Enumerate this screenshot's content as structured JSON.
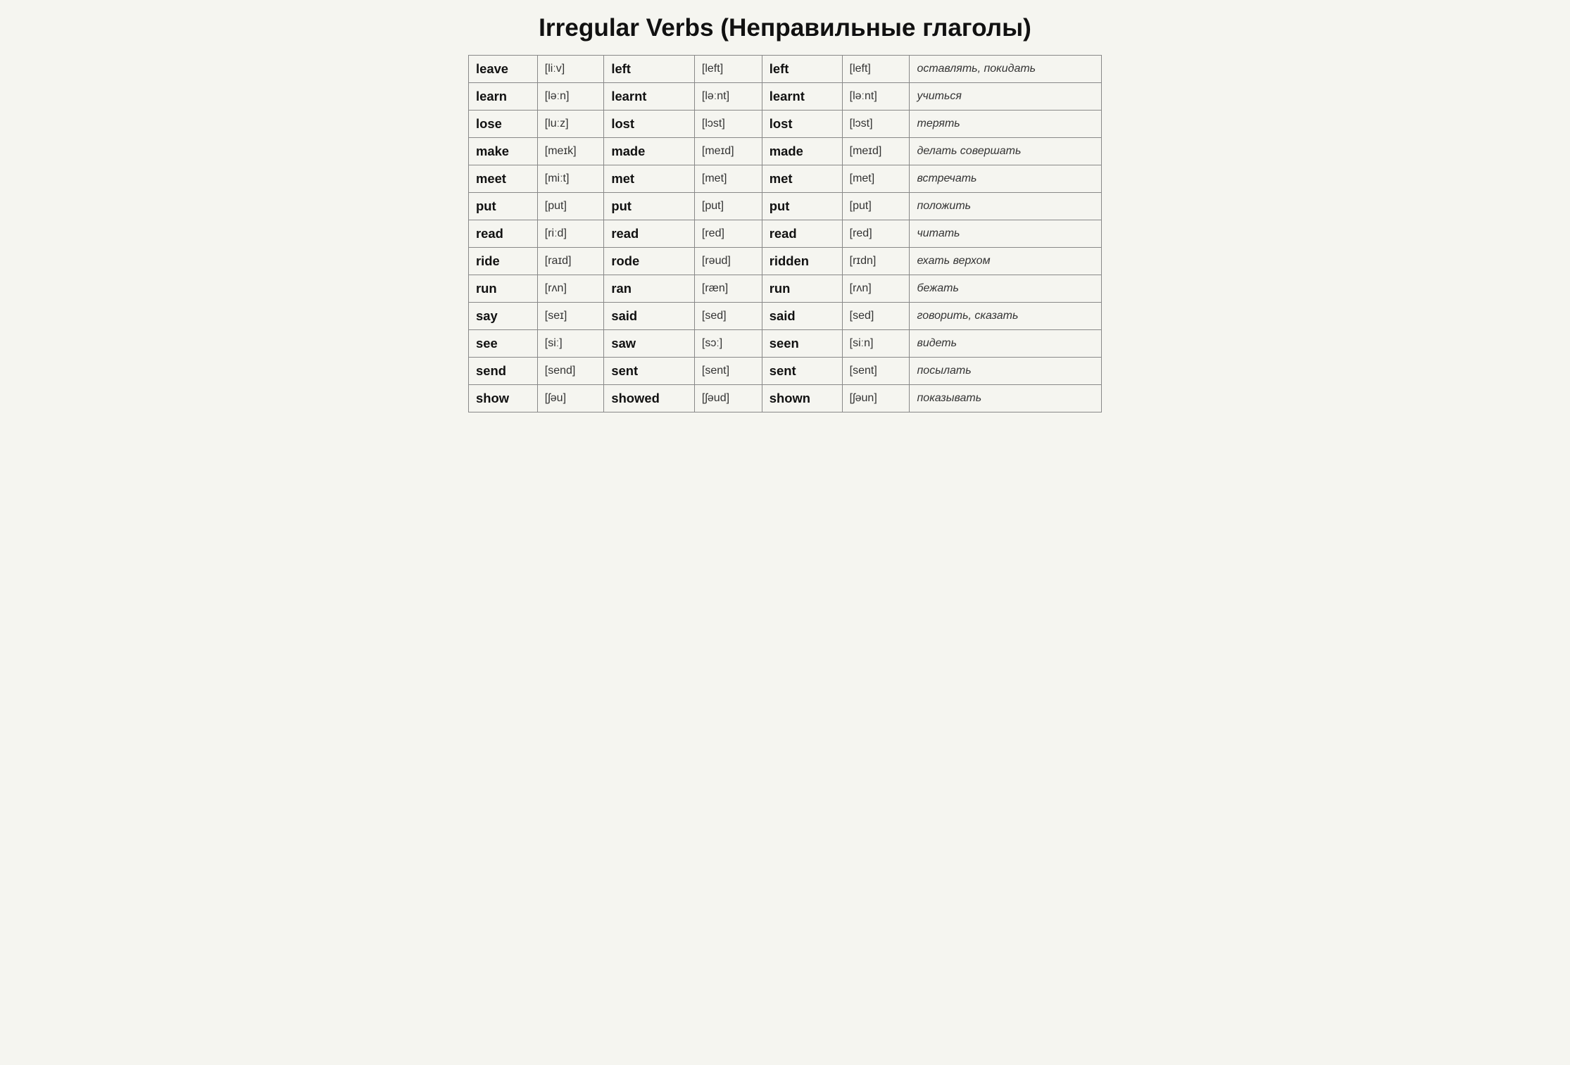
{
  "title": "Irregular Verbs (Неправильные глаголы)",
  "rows": [
    {
      "v1": "leave",
      "p1": "[liːv]",
      "v2": "left",
      "p2": "[left]",
      "v3": "left",
      "p3": "[left]",
      "tr": "оставлять, покидать"
    },
    {
      "v1": "learn",
      "p1": "[ləːn]",
      "v2": "learnt",
      "p2": "[ləːnt]",
      "v3": "learnt",
      "p3": "[ləːnt]",
      "tr": "учиться"
    },
    {
      "v1": "lose",
      "p1": "[luːz]",
      "v2": "lost",
      "p2": "[lɔst]",
      "v3": "lost",
      "p3": "[lɔst]",
      "tr": "терять"
    },
    {
      "v1": "make",
      "p1": "[meɪk]",
      "v2": "made",
      "p2": "[meɪd]",
      "v3": "made",
      "p3": "[meɪd]",
      "tr": "делать совершать"
    },
    {
      "v1": "meet",
      "p1": "[miːt]",
      "v2": "met",
      "p2": "[met]",
      "v3": "met",
      "p3": "[met]",
      "tr": "встречать"
    },
    {
      "v1": "put",
      "p1": "[put]",
      "v2": "put",
      "p2": "[put]",
      "v3": "put",
      "p3": "[put]",
      "tr": "положить"
    },
    {
      "v1": "read",
      "p1": "[riːd]",
      "v2": "read",
      "p2": "[red]",
      "v3": "read",
      "p3": "[red]",
      "tr": "читать"
    },
    {
      "v1": "ride",
      "p1": "[raɪd]",
      "v2": "rode",
      "p2": "[rəud]",
      "v3": "ridden",
      "p3": "[rɪdn]",
      "tr": "ехать верхом"
    },
    {
      "v1": "run",
      "p1": "[rʌn]",
      "v2": "ran",
      "p2": "[ræn]",
      "v3": "run",
      "p3": "[rʌn]",
      "tr": "бежать"
    },
    {
      "v1": "say",
      "p1": "[seɪ]",
      "v2": "said",
      "p2": "[sed]",
      "v3": "said",
      "p3": "[sed]",
      "tr": "говорить, сказать"
    },
    {
      "v1": "see",
      "p1": "[siː]",
      "v2": "saw",
      "p2": "[sɔː]",
      "v3": "seen",
      "p3": "[siːn]",
      "tr": "видеть"
    },
    {
      "v1": "send",
      "p1": "[send]",
      "v2": "sent",
      "p2": "[sent]",
      "v3": "sent",
      "p3": "[sent]",
      "tr": "посылать"
    },
    {
      "v1": "show",
      "p1": "[ʃəu]",
      "v2": "showed",
      "p2": "[ʃəud]",
      "v3": "shown",
      "p3": "[ʃəun]",
      "tr": "показывать"
    }
  ]
}
